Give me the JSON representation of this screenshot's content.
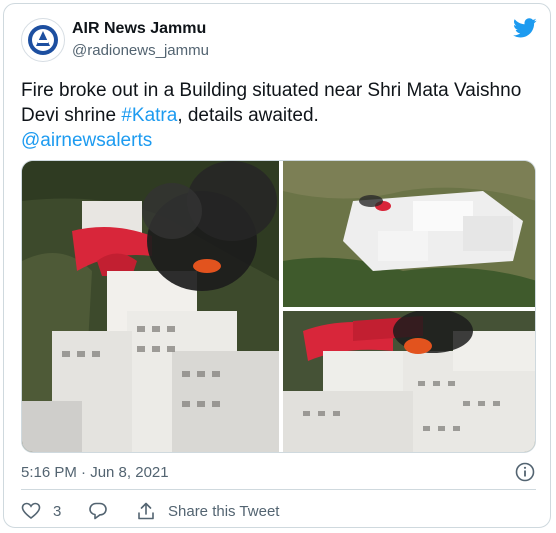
{
  "tweet": {
    "author_name": "AIR News Jammu",
    "author_handle": "@radionews_jammu",
    "text_before": "Fire broke out in a Building situated near Shri Mata Vaishno Devi shrine ",
    "hashtag": "#Katra",
    "text_after": ", details awaited.",
    "mention": "@airnewsalerts",
    "timestamp": "5:16 PM · Jun 8, 2021",
    "like_count": "3",
    "share_label": "Share this Tweet"
  },
  "media": {
    "photos": [
      {
        "name": "fire-photo-closeup"
      },
      {
        "name": "shrine-photo-aerial"
      },
      {
        "name": "fire-photo-smoke"
      }
    ]
  },
  "colors": {
    "accent": "#1d9bf0",
    "text": "#0f1419",
    "secondary_text": "#536471",
    "border": "#cfd9de",
    "roof_red": "#d8263a",
    "smoke": "#1c1c1c"
  },
  "icons": [
    "avatar-logo",
    "twitter-bird-icon",
    "info-icon",
    "heart-icon",
    "reply-icon",
    "share-icon"
  ]
}
